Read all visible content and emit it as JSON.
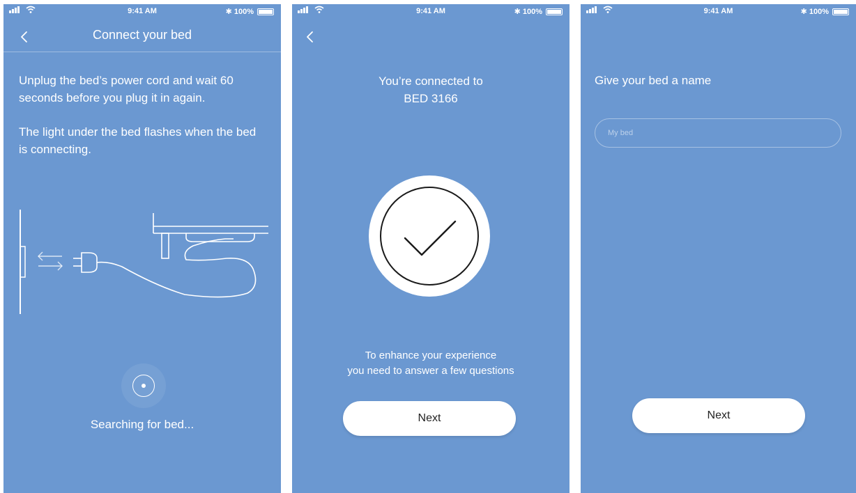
{
  "status_bar": {
    "time": "9:41 AM",
    "battery": "100%"
  },
  "icons": {
    "back": "chevron-left-icon",
    "signal": "signal-icon",
    "wifi": "wifi-icon",
    "bluetooth": "bluetooth-icon",
    "battery": "battery-icon",
    "check": "checkmark-icon",
    "plug": "plug-illustration"
  },
  "colors": {
    "background": "#6b98d1",
    "button": "#ffffff",
    "button_text": "#222222"
  },
  "screen1": {
    "title": "Connect your bed",
    "instruction_1": "Unplug the bed’s power cord and wait 60 seconds before you plug it in again.",
    "instruction_2": "The light under the bed flashes when the bed is connecting.",
    "searching": "Searching for bed..."
  },
  "screen2": {
    "connected_line": "You’re connected to",
    "bed_name": "BED 3166",
    "enhance_line_1": "To enhance your experience",
    "enhance_line_2": "you need to answer a few questions",
    "next_label": "Next"
  },
  "screen3": {
    "prompt": "Give your bed a name",
    "name_placeholder": "My bed",
    "next_label": "Next"
  }
}
